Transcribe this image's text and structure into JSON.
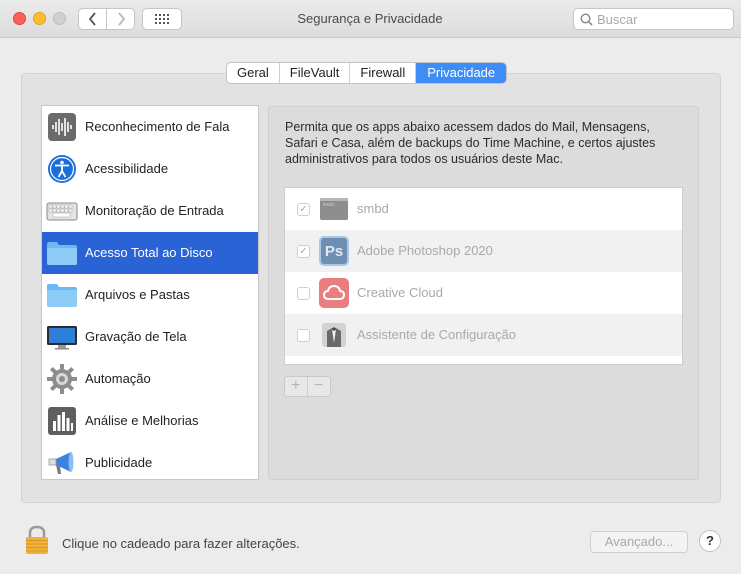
{
  "window": {
    "title": "Segurança e Privacidade",
    "search_placeholder": "Buscar"
  },
  "tabs": [
    {
      "label": "Geral",
      "active": false
    },
    {
      "label": "FileVault",
      "active": false
    },
    {
      "label": "Firewall",
      "active": false
    },
    {
      "label": "Privacidade",
      "active": true
    }
  ],
  "sidebar": {
    "items": [
      {
        "label": "Reconhecimento de Fala",
        "icon": "waveform-icon",
        "selected": false
      },
      {
        "label": "Acessibilidade",
        "icon": "accessibility-icon",
        "selected": false
      },
      {
        "label": "Monitoração de Entrada",
        "icon": "keyboard-icon",
        "selected": false
      },
      {
        "label": "Acesso Total ao Disco",
        "icon": "folder-icon",
        "selected": true
      },
      {
        "label": "Arquivos e Pastas",
        "icon": "folder-icon",
        "selected": false
      },
      {
        "label": "Gravação de Tela",
        "icon": "display-icon",
        "selected": false
      },
      {
        "label": "Automação",
        "icon": "gear-icon",
        "selected": false
      },
      {
        "label": "Análise e Melhorias",
        "icon": "bar-chart-icon",
        "selected": false
      },
      {
        "label": "Publicidade",
        "icon": "megaphone-icon",
        "selected": false
      }
    ]
  },
  "main": {
    "description": "Permita que os apps abaixo acessem dados do Mail, Mensagens, Safari e Casa, além de backups do Time Machine, e certos ajustes administrativos para todos os usuários deste Mac.",
    "apps": [
      {
        "name": "smbd",
        "checked": true,
        "icon": "terminal-icon"
      },
      {
        "name": "Adobe Photoshop 2020",
        "checked": true,
        "icon": "photoshop-icon",
        "icon_text": "Ps"
      },
      {
        "name": "Creative Cloud",
        "checked": false,
        "icon": "creative-cloud-icon"
      },
      {
        "name": "Assistente de Configuração",
        "checked": false,
        "icon": "setup-assistant-icon"
      }
    ],
    "plus_label": "+",
    "minus_label": "−"
  },
  "footer": {
    "lock_text": "Clique no cadeado para fazer alterações.",
    "advanced_label": "Avançado...",
    "help_label": "?"
  },
  "colors": {
    "accent": "#3e8df7",
    "selection": "#2a63d6",
    "close": "#fe5f57",
    "minimize": "#febc2e"
  }
}
